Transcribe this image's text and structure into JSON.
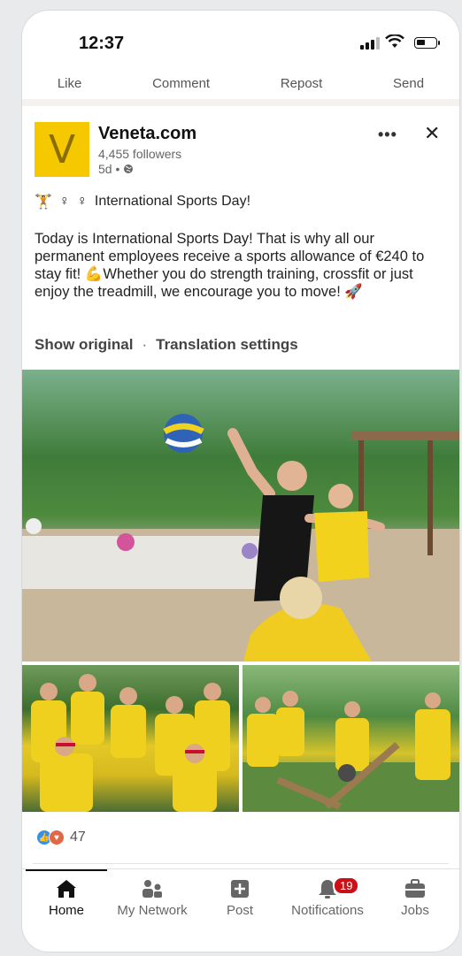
{
  "status_bar": {
    "time": "12:37"
  },
  "action_bar": {
    "like": "Like",
    "comment": "Comment",
    "repost": "Repost",
    "send": "Send"
  },
  "post": {
    "logo_letter": "V",
    "company": "Veneta.com",
    "followers": "4,455 followers",
    "age": "5d •",
    "headline": "International Sports Day!",
    "body": "Today is International Sports Day! That is why all our permanent employees receive a sports allowance of €240 to stay fit! 💪Whether you do strength training, crossfit or just enjoy the treadmill, we encourage you to move! 🚀",
    "show_original": "Show original",
    "separator": "·",
    "translation_settings": "Translation settings",
    "reaction_count": "47"
  },
  "tabs": [
    {
      "label": "Home",
      "icon": "home-icon"
    },
    {
      "label": "My Network",
      "icon": "network-icon"
    },
    {
      "label": "Post",
      "icon": "post-icon"
    },
    {
      "label": "Notifications",
      "icon": "bell-icon",
      "badge": "19"
    },
    {
      "label": "Jobs",
      "icon": "briefcase-icon"
    }
  ],
  "colors": {
    "logo_bg": "#f5c800",
    "badge": "#cc1016",
    "like": "#378fe9",
    "love": "#e16745"
  }
}
